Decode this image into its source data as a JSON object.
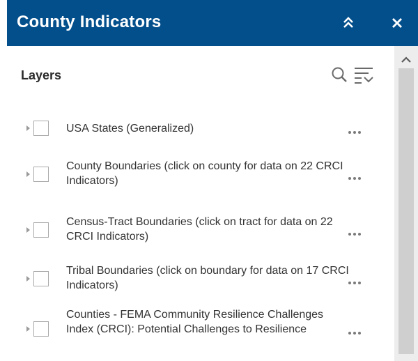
{
  "panel": {
    "title": "County Indicators",
    "header_color": "#034f8c",
    "collapse_icon": "double-chevron-up-icon",
    "close_icon": "close-icon"
  },
  "layers": {
    "title": "Layers",
    "items": [
      {
        "label": "USA States (Generalized)",
        "checked": false
      },
      {
        "label": "County Boundaries (click on county for data on 22 CRCI Indicators)",
        "checked": false
      },
      {
        "label": "Census-Tract Boundaries (click on tract for data on 22 CRCI Indicators)",
        "checked": false
      },
      {
        "label": "Tribal Boundaries (click on boundary for data on 17 CRCI Indicators)",
        "checked": false
      },
      {
        "label": "Counties - FEMA Community Resilience Challenges Index (CRCI): Potential Challenges to Resilience",
        "checked": false
      }
    ]
  }
}
